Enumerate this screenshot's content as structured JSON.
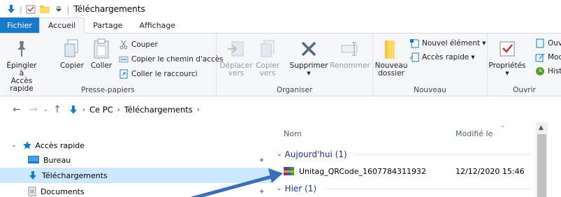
{
  "window": {
    "title": "Téléchargements"
  },
  "tabs": [
    {
      "label": "Fichier"
    },
    {
      "label": "Accueil"
    },
    {
      "label": "Partage"
    },
    {
      "label": "Affichage"
    }
  ],
  "ribbon": {
    "clipboard": {
      "pin_label_1": "Épingler à",
      "pin_label_2": "Accès rapide",
      "copy_label": "Copier",
      "paste_label": "Coller",
      "cut_label": "Couper",
      "copy_path_label": "Copier le chemin d'accès",
      "paste_shortcut_label": "Coller le raccourci",
      "group_label": "Presse-papiers"
    },
    "organize": {
      "move_label_1": "Déplacer",
      "move_label_2": "vers",
      "copyto_label_1": "Copier",
      "copyto_label_2": "vers",
      "delete_label": "Supprimer",
      "rename_label": "Renommer",
      "group_label": "Organiser"
    },
    "new": {
      "new_folder_label_1": "Nouveau",
      "new_folder_label_2": "dossier",
      "new_item_label": "Nouvel élément",
      "quick_access_label": "Accès rapide",
      "group_label": "Nouveau"
    },
    "open": {
      "properties_label": "Propriétés",
      "open_label": "Ouv",
      "modify_label": "Mod",
      "history_label": "Hist",
      "group_label": "Ouvrir"
    }
  },
  "address": {
    "crumbs": [
      "Ce PC",
      "Téléchargements"
    ]
  },
  "navpane": {
    "quick_access": "Accès rapide",
    "items": [
      {
        "label": "Bureau"
      },
      {
        "label": "Téléchargements"
      },
      {
        "label": "Documents"
      }
    ]
  },
  "filepane": {
    "col_name": "Nom",
    "col_modified": "Modifié le",
    "groups": [
      {
        "label": "Aujourd'hui (1)"
      },
      {
        "label": "Hier (1)"
      }
    ],
    "files": [
      {
        "name": "Unitag_QRCode_1607784311932",
        "modified": "12/12/2020 15:46"
      }
    ]
  },
  "colors": {
    "accent": "#1979ca",
    "selection": "#cce8ff",
    "arrow": "#3a6fb5"
  }
}
